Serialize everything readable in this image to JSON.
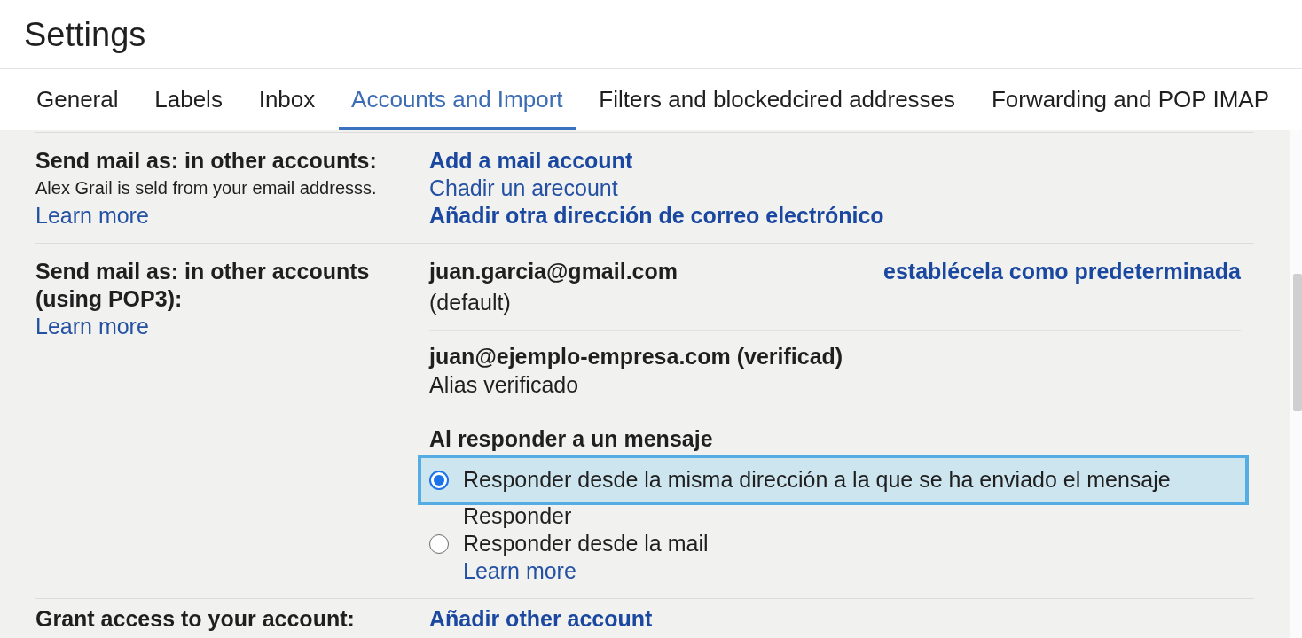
{
  "window": {
    "title": "Settings"
  },
  "tabs": [
    {
      "label": "General",
      "selected": false
    },
    {
      "label": "Labels",
      "selected": false
    },
    {
      "label": "Inbox",
      "selected": false
    },
    {
      "label": "Accounts and Import",
      "selected": true
    },
    {
      "label": "Filters and blockedcired addresses",
      "selected": false
    },
    {
      "label": "Forwarding and POP IMAP",
      "selected": false
    }
  ],
  "sections": [
    {
      "kind": "links",
      "label": "Send mail as: in other accounts:",
      "description": "Alex Grail is seld from your email addresss.",
      "learn_more": "Learn more",
      "links": [
        {
          "text": "Add a mail account",
          "bold": true
        },
        {
          "text": "Chadir un arecount",
          "bold": false
        },
        {
          "text": "Añadir otra dirección de correo electrónico",
          "bold": true
        }
      ]
    },
    {
      "kind": "addresses",
      "label": "Send mail as: in other accounts (using POP3):",
      "learn_more": "Learn more",
      "addresses": [
        {
          "address": "juan.garcia@gmail.com",
          "note": "(default)",
          "action": "establécela como predeterminada"
        },
        {
          "address": "juan@ejemplo-empresa.com (verificad)",
          "note": "Alias verificado"
        }
      ],
      "reply": {
        "heading": "Al responder a un mensaje",
        "options": [
          {
            "label": "Responder desde la misma dirección a la que se ha enviado el mensaje",
            "sublabel": "Responder",
            "selected": true
          },
          {
            "label": "Responder desde la mail",
            "link": "Learn more",
            "selected": false
          }
        ]
      }
    },
    {
      "kind": "links",
      "label": "Grant access to your account:",
      "links": [
        {
          "text": "Añadir other account",
          "bold": true
        }
      ]
    }
  ]
}
